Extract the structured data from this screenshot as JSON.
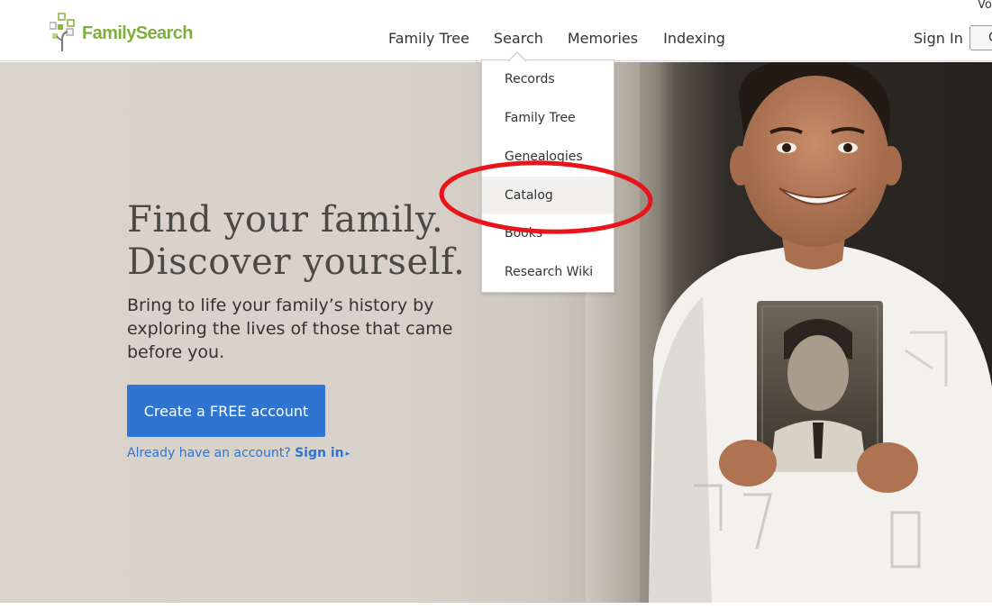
{
  "header": {
    "logo_text": "FamilySearch",
    "corner_text": "Vo",
    "nav": [
      {
        "label": "Family Tree"
      },
      {
        "label": "Search"
      },
      {
        "label": "Memories"
      },
      {
        "label": "Indexing"
      }
    ],
    "sign_in_label": "Sign In",
    "header_button_label": "C"
  },
  "dropdown": {
    "items": [
      {
        "label": "Records"
      },
      {
        "label": "Family Tree"
      },
      {
        "label": "Genealogies"
      },
      {
        "label": "Catalog"
      },
      {
        "label": "Books"
      },
      {
        "label": "Research Wiki"
      }
    ],
    "highlighted": "Catalog"
  },
  "hero": {
    "headline_line1": "Find your family.",
    "headline_line2": "Discover yourself.",
    "subtext": "Bring to life your family’s history by exploring the lives of those that came before you.",
    "cta_label": "Create a FREE account",
    "already_text": "Already have an account?",
    "sign_in_link": "Sign in",
    "caret": "▸"
  },
  "colors": {
    "brand_green": "#7fb03f",
    "cta_blue": "#2f74d0",
    "annotation_red": "#e8141b"
  }
}
